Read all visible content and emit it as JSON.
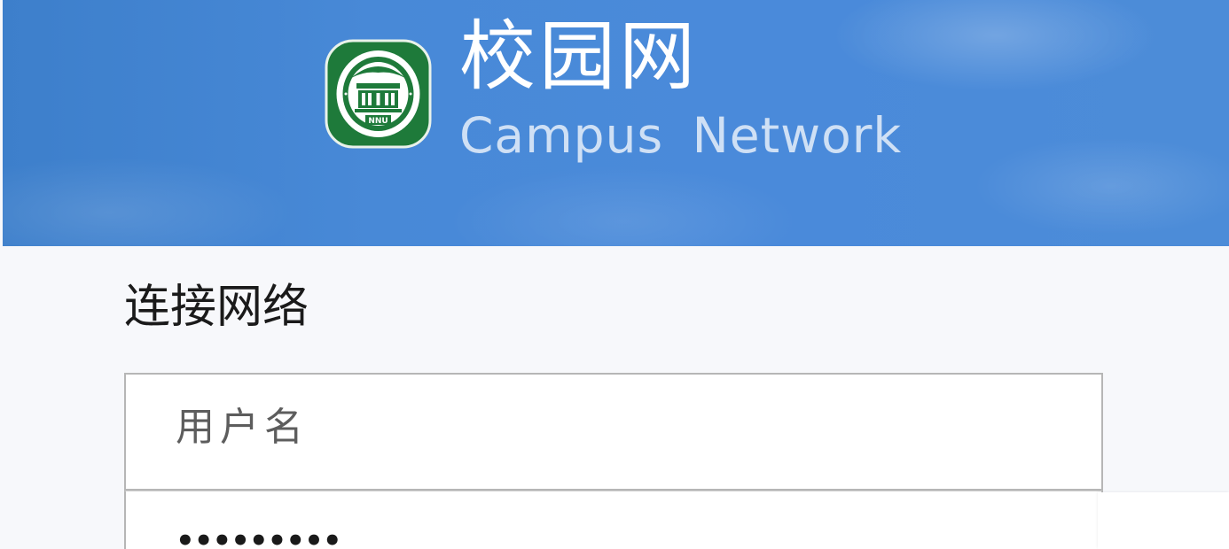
{
  "header": {
    "title_cn": "校园网",
    "title_en": "Campus Network",
    "logo": {
      "icon": "university-seal-icon",
      "seal_text": "NNU",
      "color": "#1e7a3a"
    },
    "background_color": "#4889d7"
  },
  "form": {
    "title": "连接网络",
    "username": {
      "placeholder": "用户名",
      "value": ""
    },
    "password": {
      "masked_value": "•••••••••"
    }
  }
}
